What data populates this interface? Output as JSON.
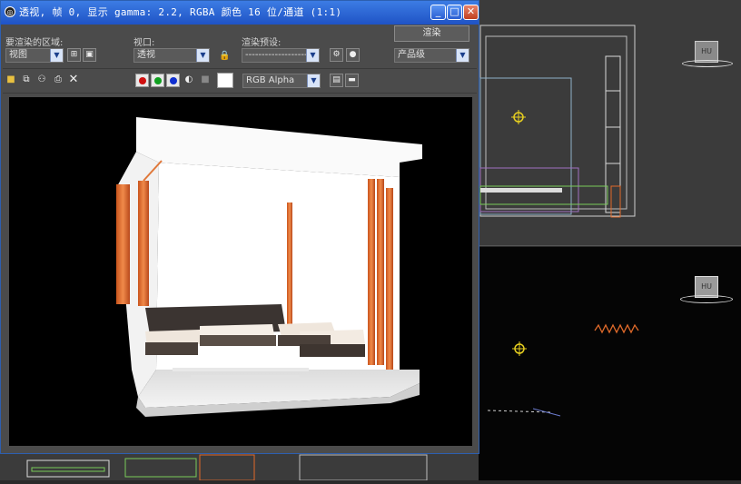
{
  "window": {
    "title": "透视, 帧 0, 显示 gamma: 2.2, RGBA 颜色 16 位/通道 (1:1)",
    "app_icon": "render-frame-icon",
    "minimize_glyph": "_",
    "maximize_glyph": "□",
    "close_glyph": "✕"
  },
  "controls": {
    "area_label": "要渲染的区域:",
    "area_value": "视图",
    "viewport_label": "视口:",
    "viewport_value": "透视",
    "preset_label": "渲染预设:",
    "preset_value": "-------------------",
    "render_button": "渲染",
    "production_value": "产品级",
    "channel_display_value": "RGB Alpha"
  },
  "colors": {
    "title_bar": "#2559cf",
    "red_channel": "#d01010",
    "green_channel": "#10a020",
    "blue_channel": "#1030d0",
    "viewport_bg": "#3b3b3b",
    "accent_orange": "#e06a2a"
  },
  "viewports": {
    "top_object_label": "HU",
    "persp_object_label": "HU"
  }
}
